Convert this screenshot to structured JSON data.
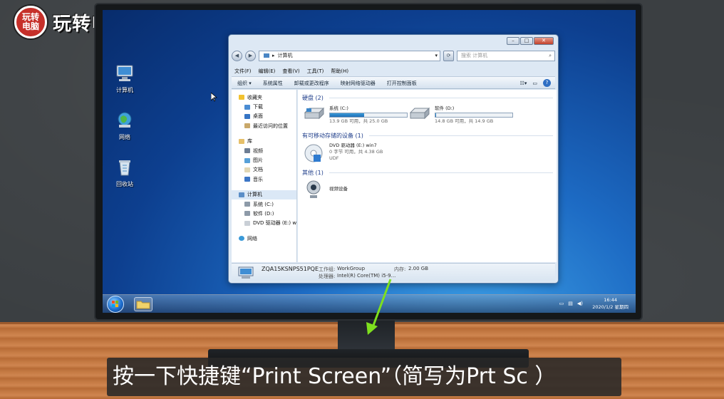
{
  "logo": {
    "badge_line1": "玩转",
    "badge_line2": "电脑",
    "text": "玩转电脑"
  },
  "desktop_icons": [
    {
      "label": "计算机",
      "icon": "computer-icon"
    },
    {
      "label": "网络",
      "icon": "network-icon"
    },
    {
      "label": "回收站",
      "icon": "recycle-bin-icon"
    }
  ],
  "window": {
    "address": "计算机",
    "search_placeholder": "搜索 计算机",
    "menu": [
      "文件(F)",
      "编辑(E)",
      "查看(V)",
      "工具(T)",
      "帮助(H)"
    ],
    "toolbar": [
      "组织 ▾",
      "系统属性",
      "卸载或更改程序",
      "映射网络驱动器",
      "打开控制面板"
    ],
    "nav": {
      "favorites_header": "收藏夹",
      "favorites": [
        "下载",
        "桌面",
        "最近访问的位置"
      ],
      "libraries_header": "库",
      "libraries": [
        "视频",
        "图片",
        "文档",
        "音乐"
      ],
      "computer_header": "计算机",
      "computer": [
        "系统 (C:)",
        "软件 (D:)",
        "DVD 驱动器 (E:) win"
      ],
      "network": "网络"
    },
    "hdd_header": "硬盘 (2)",
    "drives": [
      {
        "name": "系统 (C:)",
        "usage": "13.9 GB 可用，共 25.0 GB",
        "fill": 0.44
      },
      {
        "name": "软件 (D:)",
        "usage": "14.8 GB 可用，共 14.9 GB",
        "fill": 0.01
      }
    ],
    "removable_header": "有可移动存储的设备 (1)",
    "dvd": {
      "name": "DVD 驱动器 (E:) win7",
      "usage": "0 字节 可用，共 4.38 GB",
      "fs": "UDF"
    },
    "other_header": "其他 (1)",
    "webcam": "视频设备",
    "details": {
      "pc_name": "ZQA15KSNPS51PQE",
      "workgroup_label": "工作组:",
      "workgroup": "WorkGroup",
      "memory_label": "内存:",
      "memory": "2.00 GB",
      "cpu_label": "处理器:",
      "cpu": "Intel(R) Core(TM) i5-9..."
    }
  },
  "taskbar": {
    "time": "16:44",
    "date": "2020/1/2 星期四"
  },
  "subtitle": "按一下快捷键“Print Screen”（简写为Prt Sc ）"
}
